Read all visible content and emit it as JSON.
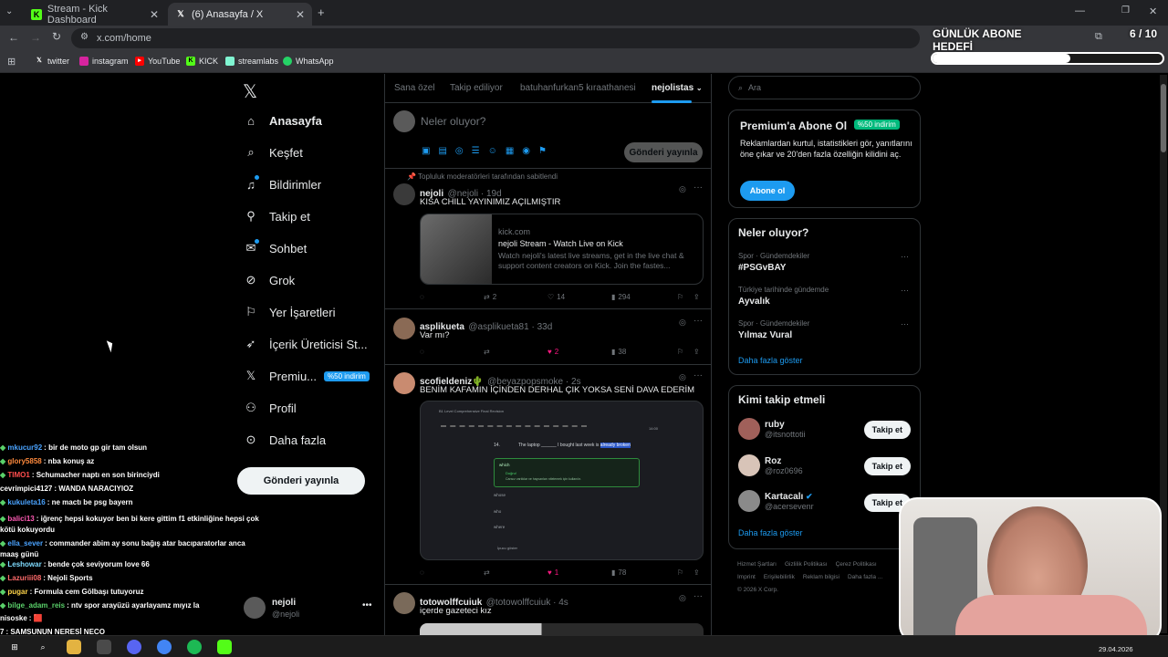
{
  "browser": {
    "tabs": [
      {
        "label": "Stream - Kick Dashboard"
      },
      {
        "label": "(6) Anasayfa / X"
      }
    ],
    "url": "x.com/home",
    "bookmarks": [
      "twitter",
      "instagram",
      "YouTube",
      "KICK",
      "streamlabs",
      "WhatsApp"
    ]
  },
  "overlay": {
    "goal_title": "GÜNLÜK ABONE HEDEFİ",
    "goal_count": "6 / 10",
    "goal_progress": 0.6
  },
  "sidebar": {
    "items": [
      {
        "label": "Anasayfa",
        "icon": "home-icon"
      },
      {
        "label": "Keşfet",
        "icon": "search-icon"
      },
      {
        "label": "Bildirimler",
        "icon": "bell-icon"
      },
      {
        "label": "Takip et",
        "icon": "add-user-icon"
      },
      {
        "label": "Sohbet",
        "icon": "chat-icon"
      },
      {
        "label": "Grok",
        "icon": "grok-icon"
      },
      {
        "label": "Yer İşaretleri",
        "icon": "bookmark-icon"
      },
      {
        "label": "İçerik Üreticisi St...",
        "icon": "rocket-icon"
      },
      {
        "label": "Premiu...",
        "icon": "x-logo-icon"
      },
      {
        "label": "Profil",
        "icon": "profile-icon"
      },
      {
        "label": "Daha fazla",
        "icon": "more-icon"
      }
    ],
    "premium_badge": "%50 indirim",
    "post_button": "Gönderi yayınla",
    "account": {
      "name": "nejoli",
      "handle": "@nejoli"
    }
  },
  "timeline": {
    "tabs": [
      "Sana özel",
      "Takip ediliyor",
      "batuhanfurkan5 kıraathanesi",
      "nejolistas"
    ],
    "compose_placeholder": "Neler oluyor?",
    "compose_button": "Gönderi yayınla",
    "pinned_label": "Topluluk moderatörleri tarafından sabitlendi",
    "posts": [
      {
        "name": "nejoli",
        "handle": "@nejoli · 19d",
        "text": "KISA CHILL YAYINIMIZ AÇILMIŞTIR",
        "card_domain": "kick.com",
        "card_title": "nejoli Stream - Watch Live on Kick",
        "card_desc": "Watch nejoli's latest live streams, get in the live chat & support content creators on Kick. Join the fastes...",
        "replies": "",
        "reposts": "2",
        "likes": "14",
        "views": "294"
      },
      {
        "name": "asplikueta",
        "handle": "@asplikueta81 · 33d",
        "text": "Var mı?",
        "replies": "",
        "reposts": "",
        "likes": "2",
        "views": "38"
      },
      {
        "name": "scofieldeniz🌵",
        "handle": "@beyazpopsmoke · 2s",
        "text": "BENİM KAFAMIN İÇİNDEN DERHAL ÇIK YOKSA SENİ DAVA EDERİM",
        "quiz_header": "B1 Level Comprehensive Final Revision",
        "quiz_timer": "14:00",
        "quiz_number": "14.",
        "quiz_question_pre": "The laptop ______ I bought last week is",
        "quiz_question_hl": "already broken",
        "quiz_options": [
          "which",
          "whose",
          "who",
          "where"
        ],
        "quiz_correct": "Doğru!",
        "quiz_explain": "Cansız varlıklar ve hayvanları nitelemek için kullanılır.",
        "quiz_hint": "İpucu göster",
        "replies": "",
        "reposts": "",
        "likes": "1",
        "views": "78"
      },
      {
        "name": "totowolffcuiuk",
        "handle": "@totowolffcuiuk · 4s",
        "text": "içerde gazeteci kız"
      }
    ]
  },
  "right": {
    "search_placeholder": "Ara",
    "premium": {
      "title": "Premium'a Abone Ol",
      "badge": "%50 indirim",
      "text": "Reklamlardan kurtul, istatistikleri gör, yanıtlarını öne çıkar ve 20'den fazla özelliğin kilidini aç.",
      "button": "Abone ol"
    },
    "trends_title": "Neler oluyor?",
    "trends": [
      {
        "context": "Spor · Gündemdekiler",
        "name": "#PSGvBAY"
      },
      {
        "context": "Türkiye tarihinde gündemde",
        "name": "Ayvalık"
      },
      {
        "context": "Spor · Gündemdekiler",
        "name": "Yılmaz Vural"
      }
    ],
    "show_more": "Daha fazla göster",
    "follow_title": "Kimi takip etmeli",
    "follow": [
      {
        "name": "ruby",
        "handle": "@itsnottotii",
        "button": "Takip et"
      },
      {
        "name": "Roz",
        "handle": "@roz0696",
        "button": "Takip et"
      },
      {
        "name": "Kartacalı",
        "handle": "@acersevenr",
        "button": "Takip et"
      }
    ],
    "follow_more": "Daha fazla göster",
    "footer": [
      "Hizmet Şartları",
      "Gizlilik Politikası",
      "Çerez Politikası",
      "Imprint",
      "Erişilebilirlik",
      "Reklam bilgisi",
      "Daha fazla ...",
      "© 2026 X Corp."
    ]
  },
  "chat": [
    {
      "user": "mkucur92",
      "msg": "bir de moto gp gir tam olsun",
      "color": "#4aa3ff"
    },
    {
      "user": "glory5858",
      "msg": "nba konuş az",
      "color": "#ff8a3d"
    },
    {
      "user": "TIMO1",
      "msg": "Schumacher naptı en son birinciydi",
      "color": "#ff4d4d"
    },
    {
      "user": "cevrimpici4127",
      "msg": "WANDA NARACIYIOZ",
      "color": "#ffffff"
    },
    {
      "user": "kukuleta16",
      "msg": "ne mactı be psg bayern",
      "color": "#4aa3ff"
    },
    {
      "user": "balici13",
      "msg": "iğrenç hepsi kokuyor ben bi kere gittim f1 etkinliğine hepsi çok kötü kokuyordu",
      "color": "#ff5ab4"
    },
    {
      "user": "ella_sever",
      "msg": "commander abim ay sonu bağış atar bacıparatorlar anca maaş günü",
      "color": "#4aa3ff"
    },
    {
      "user": "Leshowar",
      "msg": "bende çok seviyorum love 66",
      "color": "#7fdcff"
    },
    {
      "user": "Lazuriii08",
      "msg": "Nejoli Sports",
      "color": "#ff6b6b"
    },
    {
      "user": "pugar",
      "msg": "Formula cem Gölbaşı tutuyoruz",
      "color": "#ffd54a"
    },
    {
      "user": "bilge_adam_reis",
      "msg": "ntv spor arayüzü ayarlayamz mıyız la",
      "color": "#5ad16a"
    },
    {
      "user": "nisoske",
      "msg": "🟥",
      "color": "#ffffff"
    },
    {
      "user": "7",
      "msg": "SAMSUNUN NERESİ NECO",
      "color": "#ffffff"
    }
  ],
  "taskbar": {
    "date": "29.04.2026"
  },
  "colors": {
    "accent": "#1d9bf0",
    "background": "#000000",
    "border": "#2f3336",
    "like": "#f91880",
    "premium_badge": "#00ba7c"
  }
}
